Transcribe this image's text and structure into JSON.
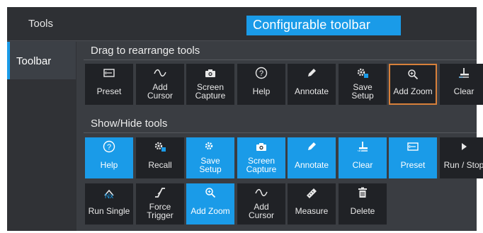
{
  "header": {
    "title": "Tools"
  },
  "callout": "Configurable toolbar",
  "sidebar": {
    "active_tab": "Toolbar"
  },
  "sections": {
    "drag": "Drag to rearrange tools",
    "show_hide": "Show/Hide tools"
  },
  "toolbar": [
    {
      "label": "Preset",
      "icon": "preset-icon"
    },
    {
      "label": "Add\nCursor",
      "icon": "add-cursor-icon"
    },
    {
      "label": "Screen\nCapture",
      "icon": "camera-icon"
    },
    {
      "label": "Help",
      "icon": "help-icon"
    },
    {
      "label": "Annotate",
      "icon": "pen-icon"
    },
    {
      "label": "Save\nSetup",
      "icon": "save-setup-icon"
    },
    {
      "label": "Add Zoom",
      "icon": "zoom-icon",
      "selected": true
    },
    {
      "label": "Clear",
      "icon": "clear-icon"
    }
  ],
  "tools": [
    {
      "label": "Help",
      "icon": "help-icon",
      "enabled": true
    },
    {
      "label": "Recall",
      "icon": "recall-icon",
      "enabled": false
    },
    {
      "label": "Save\nSetup",
      "icon": "save-setup-icon",
      "enabled": true
    },
    {
      "label": "Screen\nCapture",
      "icon": "camera-icon",
      "enabled": true
    },
    {
      "label": "Annotate",
      "icon": "pen-icon",
      "enabled": true
    },
    {
      "label": "Clear",
      "icon": "clear-icon",
      "enabled": true
    },
    {
      "label": "Preset",
      "icon": "preset-icon",
      "enabled": true
    },
    {
      "label": "Run / Stop",
      "icon": "run-stop-icon",
      "enabled": false
    },
    {
      "label": "Run Single",
      "icon": "run-single-icon",
      "enabled": false
    },
    {
      "label": "Force\nTrigger",
      "icon": "force-trigger-icon",
      "enabled": false
    },
    {
      "label": "Add Zoom",
      "icon": "zoom-icon",
      "enabled": true
    },
    {
      "label": "Add\nCursor",
      "icon": "add-cursor-icon",
      "enabled": false
    },
    {
      "label": "Measure",
      "icon": "ruler-icon",
      "enabled": false
    },
    {
      "label": "Delete",
      "icon": "trash-icon",
      "enabled": false
    }
  ],
  "run_single_badge": "Nx",
  "colors": {
    "accent": "#1a9be8",
    "selected_border": "#d8803a",
    "tile_bg": "#202226",
    "panel_bg": "#3a3d42"
  }
}
